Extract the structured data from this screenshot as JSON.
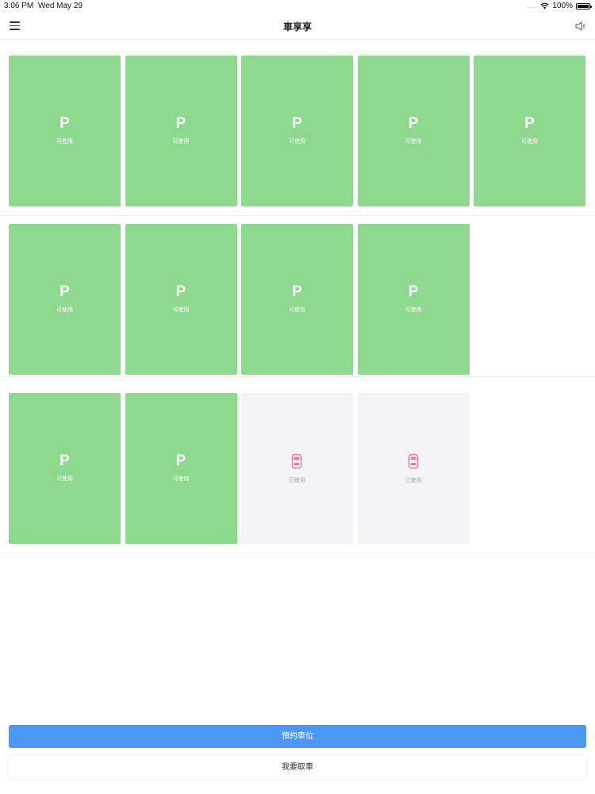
{
  "status_bar": {
    "time": "3:06 PM",
    "date": "Wed May 29",
    "signal_dots": "....",
    "battery": "100%"
  },
  "nav": {
    "title": "車享享"
  },
  "slot_text": {
    "p": "P",
    "available": "可使用",
    "occupied": "已使用"
  },
  "rows": [
    [
      "available",
      "available",
      "available",
      "available",
      "available"
    ],
    [
      "available",
      "available",
      "available",
      "available"
    ],
    [
      "available",
      "available",
      "occupied",
      "occupied"
    ]
  ],
  "actions": {
    "reserve": "預約車位",
    "pickup": "我要取車"
  },
  "colors": {
    "available": "#8dd98e",
    "occupied": "#f4f3f5",
    "primary": "#4d97f7",
    "car": "#f07895"
  }
}
